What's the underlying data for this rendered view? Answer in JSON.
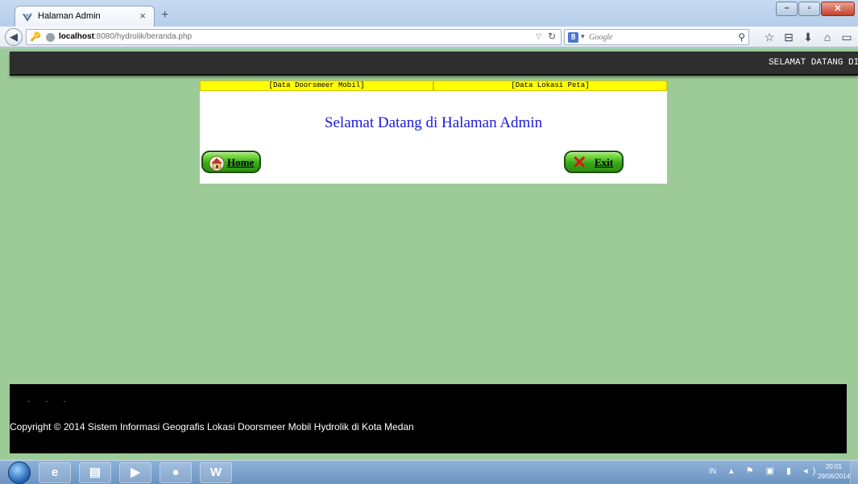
{
  "browser": {
    "tab_title": "Halaman Admin",
    "tab_close": "×",
    "new_tab": "+",
    "url_host": "localhost",
    "url_path": ":8080/hydrolik/beranda.php",
    "search_placeholder": "Google",
    "search_engine_letter": "8"
  },
  "page": {
    "marquee_text": "SELAMAT DATANG DI",
    "menu": [
      "[Data Doorsmeer Mobil]",
      "[Data Lokasi Peta]"
    ],
    "welcome": "Selamat Datang di Halaman Admin",
    "home_label": "Home",
    "exit_label": "Exit",
    "footer_dots": "· · ·",
    "copyright": "Copyright © 2014 Sistem Informasi Geografis Lokasi Doorsmeer Mobil Hydrolik di Kota Medan"
  },
  "taskbar": {
    "lang": "IN",
    "time": "20:01",
    "date": "29/06/2014"
  },
  "colors": {
    "page_bg": "#9dcb98",
    "menu_bg": "#ffff00",
    "welcome_text": "#1a1ae0",
    "button_green": "#3aa91b"
  }
}
